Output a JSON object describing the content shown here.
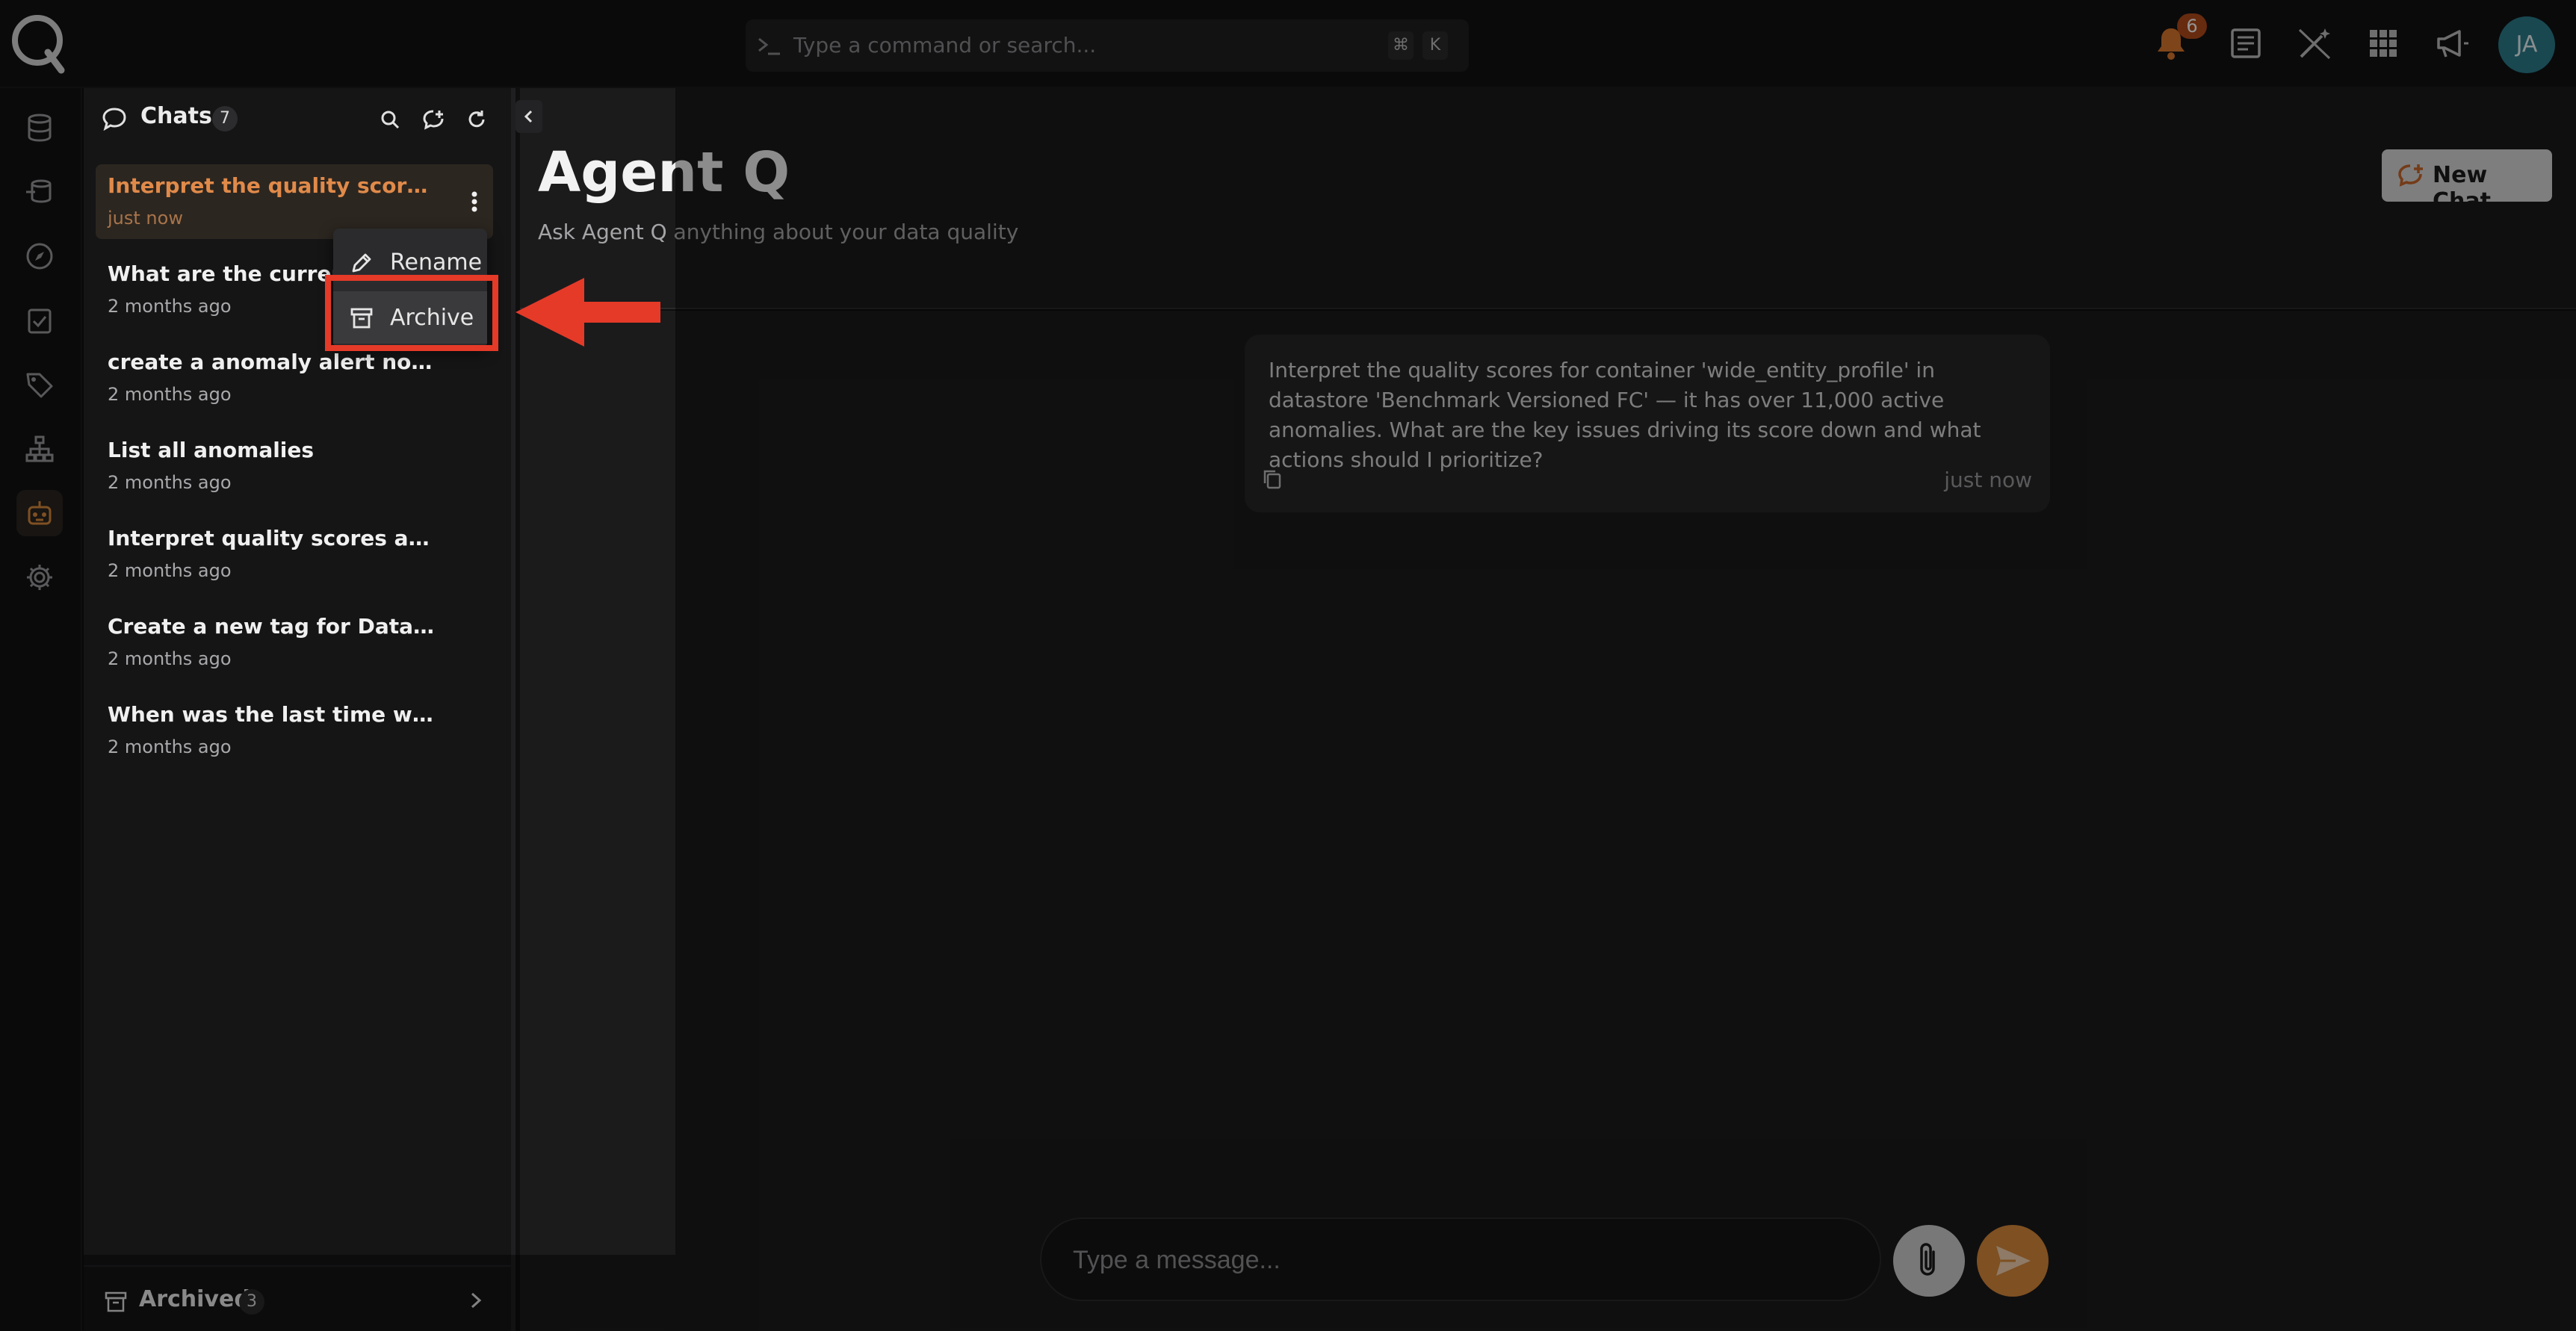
{
  "topbar": {
    "search_placeholder": "Type a command or search...",
    "shortcut_keys": [
      "⌘",
      "K"
    ],
    "notification_count": "6",
    "avatar_initials": "JA",
    "icons": [
      "bell-icon",
      "document-icon",
      "magic-wand-icon",
      "apps-grid-icon",
      "megaphone-icon"
    ]
  },
  "rail": {
    "items": [
      "database-icon",
      "datastore-icon",
      "compass-icon",
      "checklist-icon",
      "tag-icon",
      "hierarchy-icon",
      "robot-icon",
      "gear-icon"
    ],
    "active": "robot-icon"
  },
  "sidebar": {
    "title": "Chats",
    "count": "7",
    "chats": [
      {
        "title": "Interpret the quality scores for...",
        "time": "just now"
      },
      {
        "title": "What are the current d",
        "time": "2 months ago"
      },
      {
        "title": "create a anomaly alert notification ...",
        "time": "2 months ago"
      },
      {
        "title": "List all anomalies",
        "time": "2 months ago"
      },
      {
        "title": "Interpret quality scores and top an...",
        "time": "2 months ago"
      },
      {
        "title": "Create a new tag for Datastore: An...",
        "time": "2 months ago"
      },
      {
        "title": "When was the last time we have an ...",
        "time": "2 months ago"
      }
    ],
    "archived_label": "Archived",
    "archived_count": "3"
  },
  "menu": {
    "rename": "Rename",
    "archive": "Archive"
  },
  "main": {
    "title": "Agent Q",
    "subtitle": "Ask Agent Q anything about your data quality",
    "new_chat_label": "New Chat",
    "message": {
      "text": "Interpret the quality scores for container 'wide_entity_profile' in datastore 'Benchmark Versioned FC' — it has over 11,000 active anomalies. What are the key issues driving its score down and what actions should I prioritize?",
      "time": "just now"
    },
    "composer_placeholder": "Type a message..."
  },
  "colors": {
    "accent": "#d98a3c",
    "highlight": "#e53a28"
  }
}
